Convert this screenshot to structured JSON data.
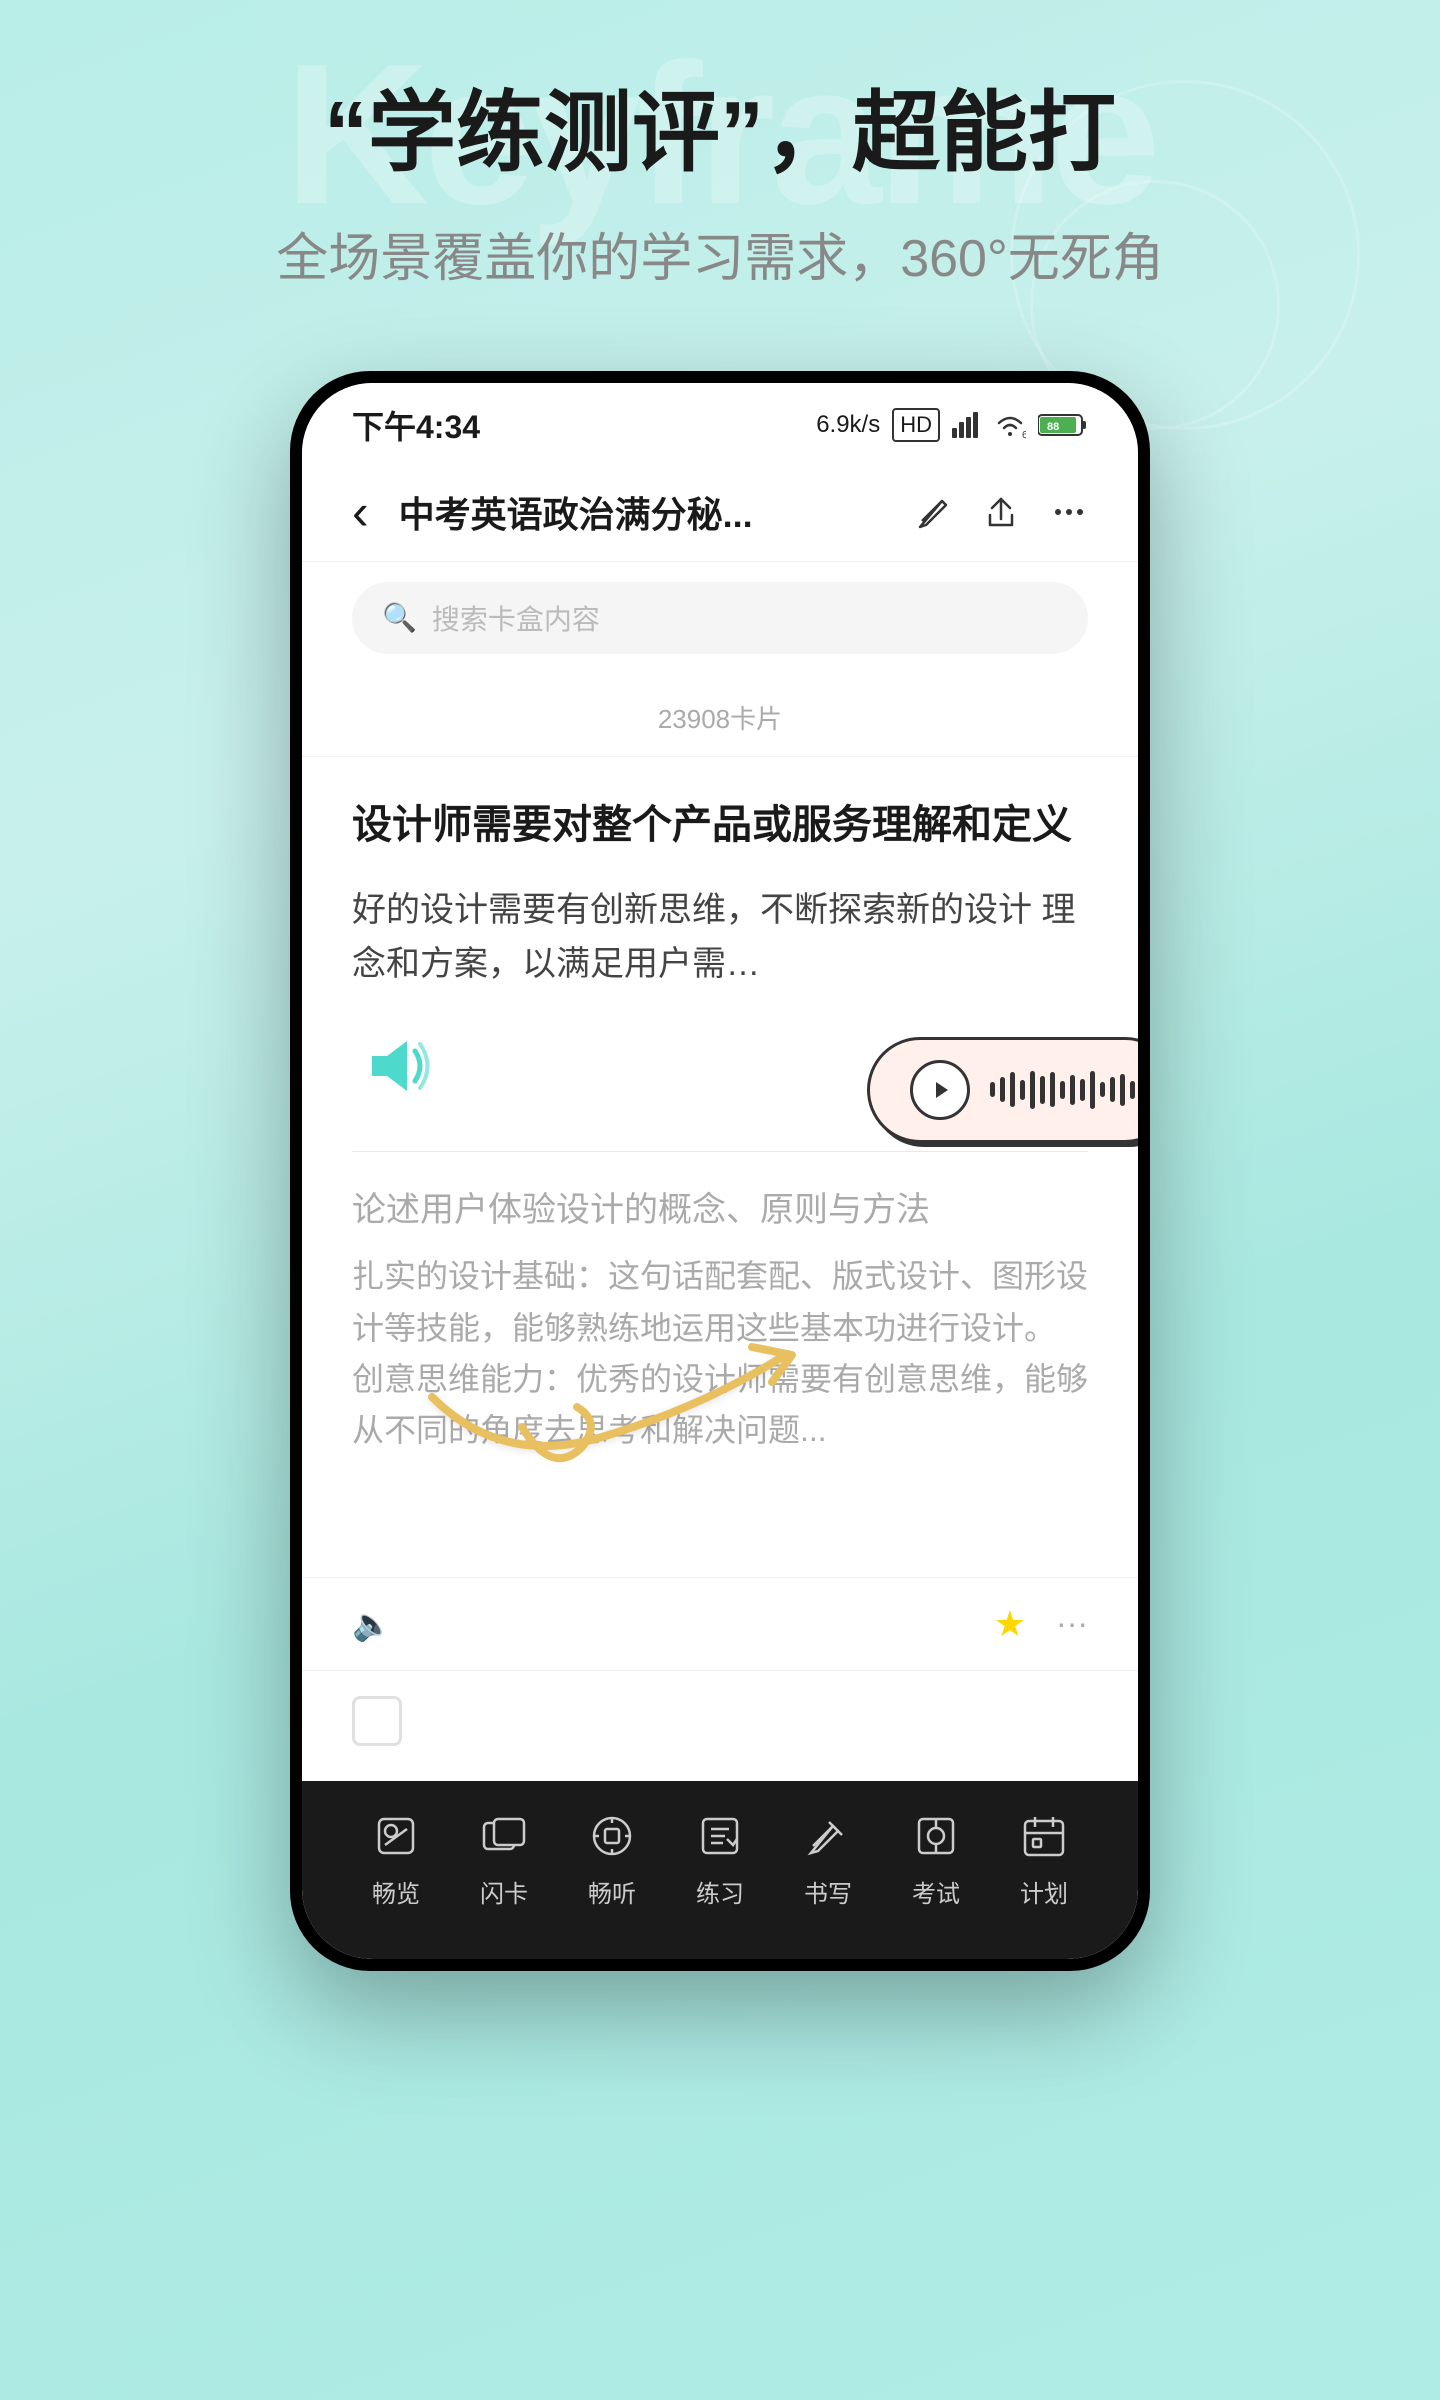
{
  "background": {
    "watermark_text": "Keyframe",
    "accent_color": "#4dd9cc"
  },
  "hero": {
    "main_title": "“学练测评”，超能打",
    "subtitle": "全场景覆盖你的学习需求，360°无死角"
  },
  "phone": {
    "status_bar": {
      "time": "下午4:34",
      "speed": "6.9k/s",
      "signal": "HD",
      "battery": "88"
    },
    "nav": {
      "title": "中考英语政治满分秘...",
      "back_label": "‹"
    },
    "search": {
      "placeholder": "搜索卡盒内容"
    },
    "card_count": "23908卡片",
    "card": {
      "question": "设计师需要对整个产品或服务理解和定义",
      "content_preview": "好的设计需要有创新思维，不断探索新的设计\n理念和方案，以满足用户需…",
      "tts_player": {
        "visible": true
      },
      "sub_title": "论述用户体验设计的概念、原则与方法",
      "sub_content": "扎实的设计基础：这句话配套配、版式设计、图形设计等技能，能够熟练地运用这些基本功进行设计。\n创意思维能力：优秀的设计师需要有创意思维，能够从不同的角度去思考和解决问题..."
    },
    "bottom_nav": {
      "items": [
        {
          "label": "畅览",
          "icon": "browse-icon"
        },
        {
          "label": "闪卡",
          "icon": "flashcard-icon"
        },
        {
          "label": "畅听",
          "icon": "listen-icon"
        },
        {
          "label": "练习",
          "icon": "practice-icon"
        },
        {
          "label": "书写",
          "icon": "write-icon"
        },
        {
          "label": "考试",
          "icon": "exam-icon"
        },
        {
          "label": "计划",
          "icon": "plan-icon"
        }
      ]
    }
  }
}
